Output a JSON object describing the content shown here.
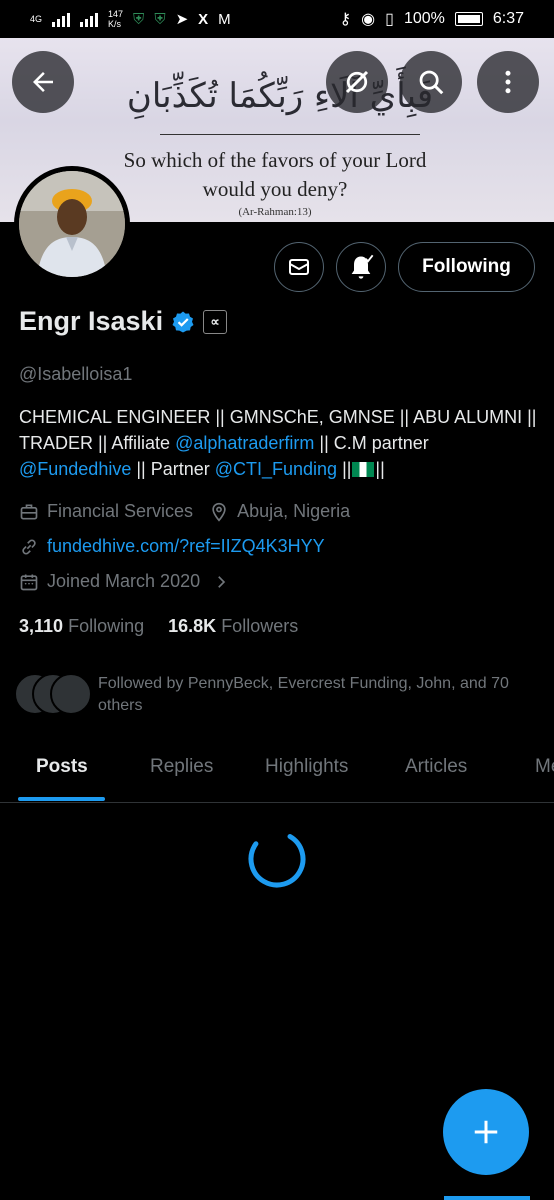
{
  "status_bar": {
    "network_type": "4G",
    "speed_value": "147",
    "speed_unit": "K/s",
    "battery": "100%",
    "time": "6:37"
  },
  "banner": {
    "arabic": "فَبِأَيِّ آلَاءِ رَبِّكُمَا تُكَذِّبَانِ",
    "english_line1": "So which of the favors of your Lord",
    "english_line2": "would you deny?",
    "reference": "(Ar-Rahman:13)"
  },
  "actions": {
    "following_label": "Following"
  },
  "profile": {
    "name": "Engr Isaski",
    "handle": "@Isabelloisa1",
    "bio_part1": "CHEMICAL ENGINEER || GMNSChE, GMNSE || ABU ALUMNI || TRADER || Affiliate ",
    "bio_link1": "@alphatraderfirm",
    "bio_part2": " || C.M partner ",
    "bio_link2": "@Fundedhive",
    "bio_part3": " || Partner ",
    "bio_link3": "@CTI_Funding",
    "bio_part4": " ||",
    "bio_part5": "||",
    "category": "Financial Services",
    "location": "Abuja, Nigeria",
    "website": "fundedhive.com/?ref=IIZQ4K3HYY",
    "joined": "Joined March 2020"
  },
  "stats": {
    "following_count": "3,110",
    "following_label": "Following",
    "followers_count": "16.8K",
    "followers_label": "Followers"
  },
  "followed_by": "Followed by PennyBeck, Evercrest Funding, John, and 70 others",
  "tabs": [
    {
      "label": "Posts",
      "active": true
    },
    {
      "label": "Replies",
      "active": false
    },
    {
      "label": "Highlights",
      "active": false
    },
    {
      "label": "Articles",
      "active": false
    },
    {
      "label": "Me",
      "active": false
    }
  ],
  "colors": {
    "accent": "#1d9bf0",
    "muted": "#71767b",
    "border": "#536471"
  }
}
